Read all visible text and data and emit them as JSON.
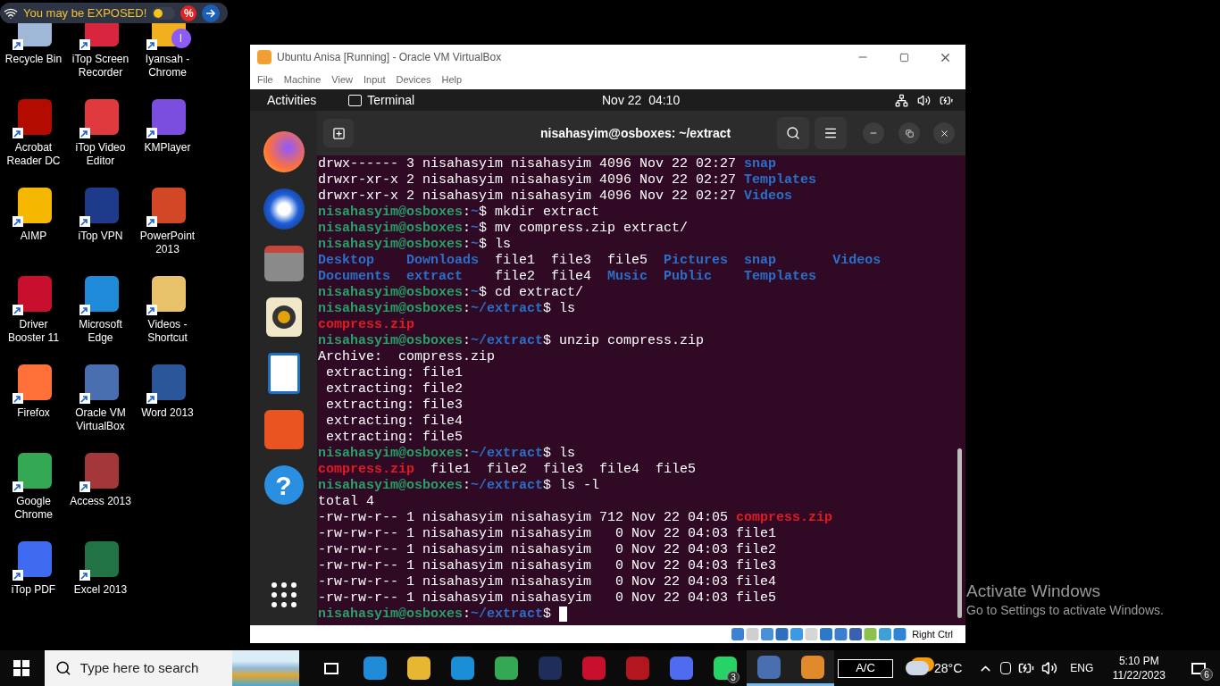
{
  "security_banner": {
    "text": "You may be EXPOSED!",
    "toggle_on": false,
    "discount_badge": "%"
  },
  "desktop_rows": [
    [
      {
        "label": "Recycle Bin"
      },
      {
        "label": "iTop Screen Recorder"
      },
      {
        "label": "Iyansah - Chrome",
        "badge": "I"
      }
    ],
    [
      {
        "label": "Acrobat Reader DC"
      },
      {
        "label": "iTop Video Editor"
      },
      {
        "label": "KMPlayer"
      }
    ],
    [
      {
        "label": "AIMP"
      },
      {
        "label": "iTop VPN"
      },
      {
        "label": "PowerPoint 2013"
      }
    ],
    [
      {
        "label": "Driver Booster 11"
      },
      {
        "label": "Microsoft Edge"
      },
      {
        "label": "Videos - Shortcut"
      }
    ],
    [
      {
        "label": "Firefox"
      },
      {
        "label": "Oracle VM VirtualBox"
      },
      {
        "label": "Word 2013"
      }
    ],
    [
      {
        "label": "Google Chrome"
      },
      {
        "label": "Access 2013"
      }
    ],
    [
      {
        "label": "iTop PDF"
      },
      {
        "label": "Excel 2013"
      }
    ]
  ],
  "vm_window": {
    "title": "Ubuntu Anisa [Running] - Oracle VM VirtualBox",
    "menu": [
      "File",
      "Machine",
      "View",
      "Input",
      "Devices",
      "Help"
    ],
    "status_bar": {
      "host_key": "Right Ctrl"
    }
  },
  "guest_topbar": {
    "activities": "Activities",
    "app": "Terminal",
    "clock": "Nov 22  04:10"
  },
  "dock": {
    "help_glyph": "?"
  },
  "terminal": {
    "title": "nisahasyim@osboxes: ~/extract",
    "cursor": true,
    "lines": [
      [
        {
          "text": "drwx------ 3 nisahasyim nisahasyim 4096 Nov 22 02:27 ",
          "kind": "plain"
        },
        {
          "text": "snap",
          "kind": "dir"
        }
      ],
      [
        {
          "text": "drwxr-xr-x 2 nisahasyim nisahasyim 4096 Nov 22 02:27 ",
          "kind": "plain"
        },
        {
          "text": "Templates",
          "kind": "dir"
        }
      ],
      [
        {
          "text": "drwxr-xr-x 2 nisahasyim nisahasyim 4096 Nov 22 02:27 ",
          "kind": "plain"
        },
        {
          "text": "Videos",
          "kind": "dir"
        }
      ],
      [
        {
          "text": "nisahasyim@osboxes",
          "kind": "user"
        },
        {
          "text": ":",
          "kind": "plain"
        },
        {
          "text": "~",
          "kind": "path"
        },
        {
          "text": "$ mkdir extract",
          "kind": "plain"
        }
      ],
      [
        {
          "text": "nisahasyim@osboxes",
          "kind": "user"
        },
        {
          "text": ":",
          "kind": "plain"
        },
        {
          "text": "~",
          "kind": "path"
        },
        {
          "text": "$ mv compress.zip extract/",
          "kind": "plain"
        }
      ],
      [
        {
          "text": "nisahasyim@osboxes",
          "kind": "user"
        },
        {
          "text": ":",
          "kind": "plain"
        },
        {
          "text": "~",
          "kind": "path"
        },
        {
          "text": "$ ls",
          "kind": "plain"
        }
      ],
      [
        {
          "text": "Desktop    ",
          "kind": "dir"
        },
        {
          "text": "Downloads",
          "kind": "dir"
        },
        {
          "text": "  file1  file3  file5  ",
          "kind": "plain"
        },
        {
          "text": "Pictures  ",
          "kind": "dir"
        },
        {
          "text": "snap       ",
          "kind": "dir"
        },
        {
          "text": "Videos",
          "kind": "dir"
        }
      ],
      [
        {
          "text": "Documents  ",
          "kind": "dir"
        },
        {
          "text": "extract",
          "kind": "dir"
        },
        {
          "text": "    file2  file4  ",
          "kind": "plain"
        },
        {
          "text": "Music  ",
          "kind": "dir"
        },
        {
          "text": "Public    ",
          "kind": "dir"
        },
        {
          "text": "Templates",
          "kind": "dir"
        }
      ],
      [
        {
          "text": "nisahasyim@osboxes",
          "kind": "user"
        },
        {
          "text": ":",
          "kind": "plain"
        },
        {
          "text": "~",
          "kind": "path"
        },
        {
          "text": "$ cd extract/",
          "kind": "plain"
        }
      ],
      [
        {
          "text": "nisahasyim@osboxes",
          "kind": "user"
        },
        {
          "text": ":",
          "kind": "plain"
        },
        {
          "text": "~/extract",
          "kind": "path"
        },
        {
          "text": "$ ls",
          "kind": "plain"
        }
      ],
      [
        {
          "text": "compress.zip",
          "kind": "zip"
        }
      ],
      [
        {
          "text": "nisahasyim@osboxes",
          "kind": "user"
        },
        {
          "text": ":",
          "kind": "plain"
        },
        {
          "text": "~/extract",
          "kind": "path"
        },
        {
          "text": "$ unzip compress.zip",
          "kind": "plain"
        }
      ],
      [
        {
          "text": "Archive:  compress.zip",
          "kind": "plain"
        }
      ],
      [
        {
          "text": " extracting: file1",
          "kind": "plain"
        }
      ],
      [
        {
          "text": " extracting: file2",
          "kind": "plain"
        }
      ],
      [
        {
          "text": " extracting: file3",
          "kind": "plain"
        }
      ],
      [
        {
          "text": " extracting: file4",
          "kind": "plain"
        }
      ],
      [
        {
          "text": " extracting: file5",
          "kind": "plain"
        }
      ],
      [
        {
          "text": "nisahasyim@osboxes",
          "kind": "user"
        },
        {
          "text": ":",
          "kind": "plain"
        },
        {
          "text": "~/extract",
          "kind": "path"
        },
        {
          "text": "$ ls",
          "kind": "plain"
        }
      ],
      [
        {
          "text": "compress.zip",
          "kind": "zip"
        },
        {
          "text": "  file1  file2  file3  file4  file5",
          "kind": "plain"
        }
      ],
      [
        {
          "text": "nisahasyim@osboxes",
          "kind": "user"
        },
        {
          "text": ":",
          "kind": "plain"
        },
        {
          "text": "~/extract",
          "kind": "path"
        },
        {
          "text": "$ ls -l",
          "kind": "plain"
        }
      ],
      [
        {
          "text": "total 4",
          "kind": "plain"
        }
      ],
      [
        {
          "text": "-rw-rw-r-- 1 nisahasyim nisahasyim 712 Nov 22 04:05 ",
          "kind": "plain"
        },
        {
          "text": "compress.zip",
          "kind": "zip"
        }
      ],
      [
        {
          "text": "-rw-rw-r-- 1 nisahasyim nisahasyim   0 Nov 22 04:03 file1",
          "kind": "plain"
        }
      ],
      [
        {
          "text": "-rw-rw-r-- 1 nisahasyim nisahasyim   0 Nov 22 04:03 file2",
          "kind": "plain"
        }
      ],
      [
        {
          "text": "-rw-rw-r-- 1 nisahasyim nisahasyim   0 Nov 22 04:03 file3",
          "kind": "plain"
        }
      ],
      [
        {
          "text": "-rw-rw-r-- 1 nisahasyim nisahasyim   0 Nov 22 04:03 file4",
          "kind": "plain"
        }
      ],
      [
        {
          "text": "-rw-rw-r-- 1 nisahasyim nisahasyim   0 Nov 22 04:03 file5",
          "kind": "plain"
        }
      ],
      [
        {
          "text": "nisahasyim@osboxes",
          "kind": "user"
        },
        {
          "text": ":",
          "kind": "plain"
        },
        {
          "text": "~/extract",
          "kind": "path"
        },
        {
          "text": "$",
          "kind": "plain"
        }
      ]
    ]
  },
  "activation_notice": {
    "title": "Activate Windows",
    "message": "Go to Settings to activate Windows."
  },
  "taskbar": {
    "search_placeholder": "Type here to search",
    "apps": [
      {
        "active": false
      },
      {
        "active": false
      },
      {
        "active": false
      },
      {
        "active": false
      },
      {
        "active": false
      },
      {
        "active": false
      },
      {
        "active": false
      },
      {
        "active": false
      },
      {
        "active": false,
        "badge": "3"
      },
      {
        "active": true
      },
      {
        "active": true
      }
    ],
    "power": "A/C",
    "temperature": "28°C",
    "language": "ENG",
    "time": "5:10 PM",
    "date": "11/22/2023",
    "notifications": "6"
  }
}
